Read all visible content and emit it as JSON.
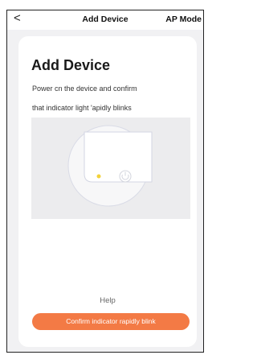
{
  "header": {
    "back_glyph": "<",
    "title": "Add Device",
    "ap_mode_label": "AP Mode"
  },
  "card": {
    "heading": "Add Device",
    "description_line1": "Power cn the device and confirm",
    "description_line2": "that indicator light 'apidly blinks",
    "help_label": "Help",
    "confirm_button_label": "Confirm indicator rapidly blink"
  },
  "colors": {
    "accent": "#f37a45",
    "indicator_light": "#f3d23a",
    "page_background": "#f1f1f3"
  },
  "icons": [
    "back-chevron-icon",
    "device-illustration",
    "indicator-light-icon",
    "power-icon"
  ]
}
